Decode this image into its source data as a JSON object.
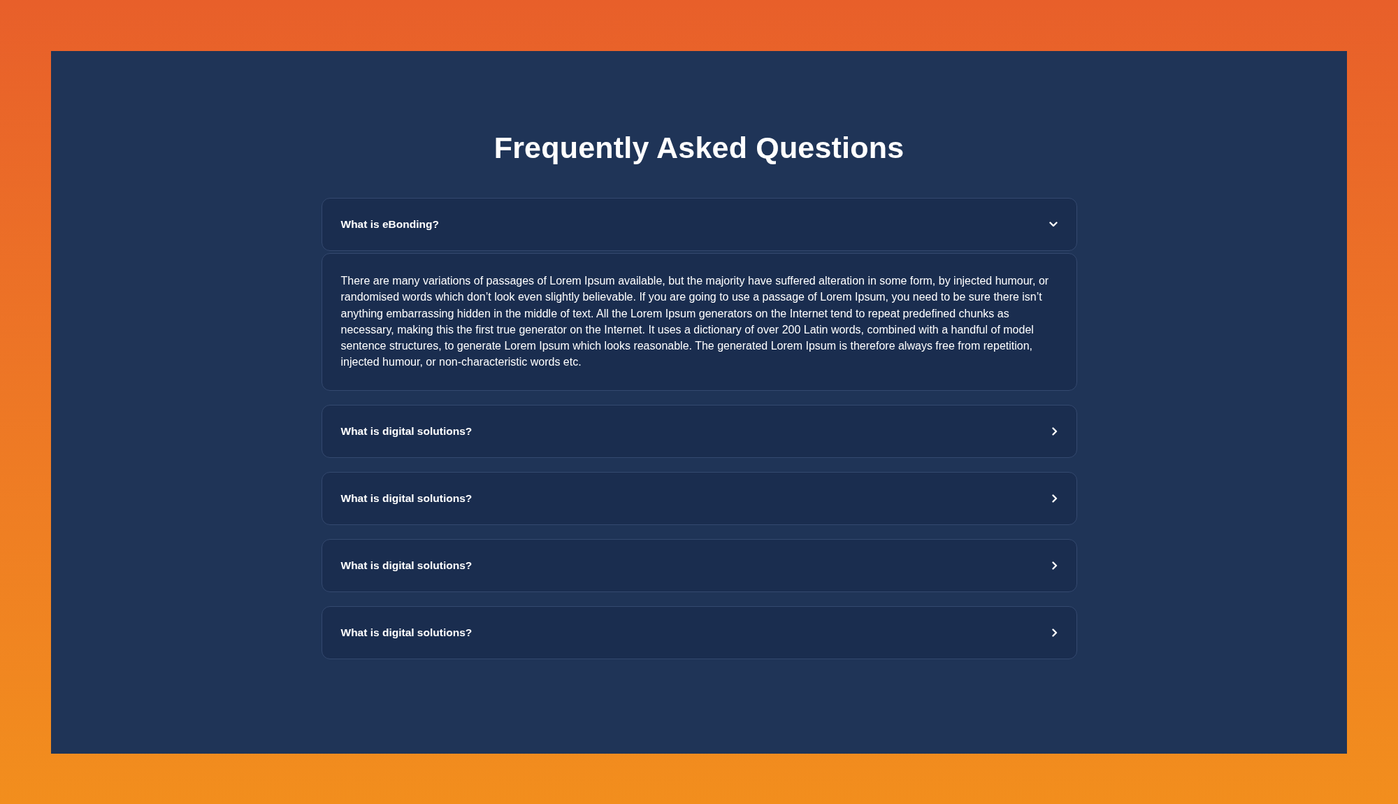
{
  "title": "Frequently Asked Questions",
  "faq_items": [
    {
      "question": "What is eBonding?",
      "expanded": true,
      "answer": "There are many variations of passages of Lorem Ipsum available, but the majority have suffered alteration in some form, by injected humour, or randomised words which don’t look even slightly believable. If you are going to use a passage of Lorem Ipsum, you need to be sure there isn’t anything embarrassing hidden in the middle of text. All the Lorem Ipsum generators on the Internet tend to repeat predefined chunks as necessary, making this the first true generator on the Internet. It uses a dictionary of over 200 Latin words, combined with a handful of model sentence structures, to generate Lorem Ipsum which looks reasonable. The generated Lorem Ipsum is therefore always free from repetition, injected humour, or non-characteristic words etc."
    },
    {
      "question": "What is digital solutions?",
      "expanded": false
    },
    {
      "question": "What is digital solutions?",
      "expanded": false
    },
    {
      "question": "What is digital solutions?",
      "expanded": false
    },
    {
      "question": "What is digital solutions?",
      "expanded": false
    }
  ]
}
